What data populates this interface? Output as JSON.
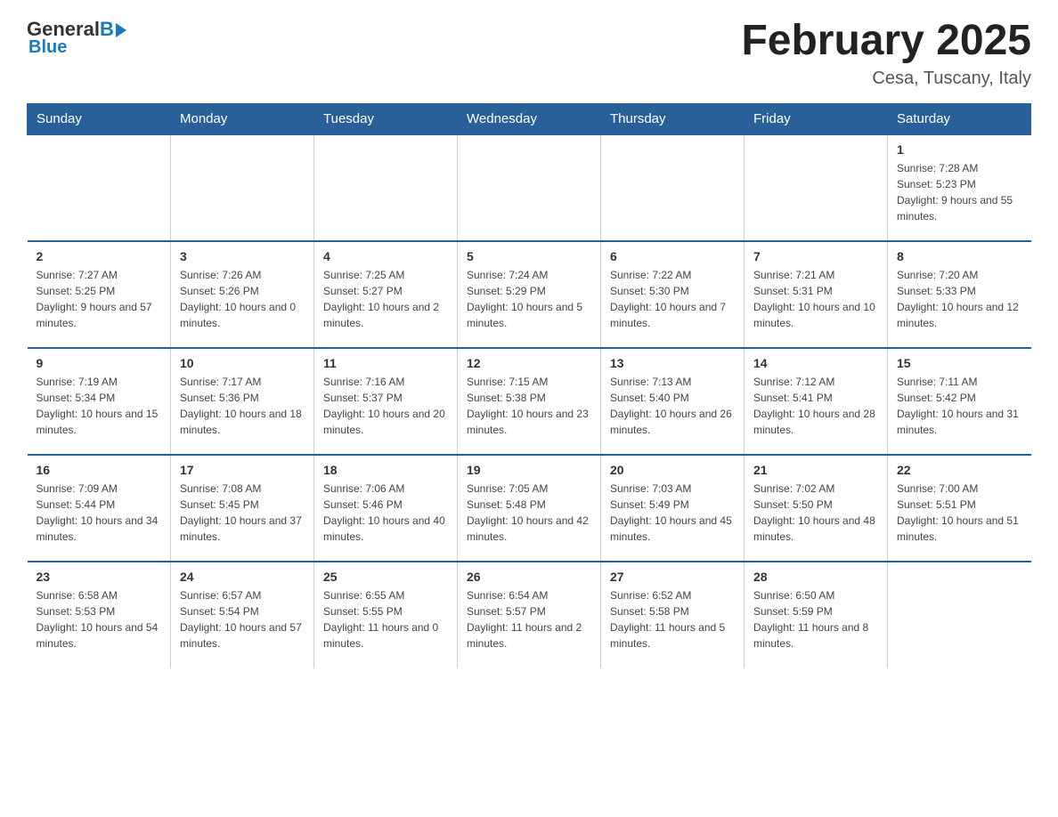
{
  "logo": {
    "general": "General",
    "blue": "Blue",
    "subtitle": "Blue"
  },
  "title": "February 2025",
  "location": "Cesa, Tuscany, Italy",
  "days_of_week": [
    "Sunday",
    "Monday",
    "Tuesday",
    "Wednesday",
    "Thursday",
    "Friday",
    "Saturday"
  ],
  "weeks": [
    [
      {
        "day": "",
        "info": ""
      },
      {
        "day": "",
        "info": ""
      },
      {
        "day": "",
        "info": ""
      },
      {
        "day": "",
        "info": ""
      },
      {
        "day": "",
        "info": ""
      },
      {
        "day": "",
        "info": ""
      },
      {
        "day": "1",
        "info": "Sunrise: 7:28 AM\nSunset: 5:23 PM\nDaylight: 9 hours and 55 minutes."
      }
    ],
    [
      {
        "day": "2",
        "info": "Sunrise: 7:27 AM\nSunset: 5:25 PM\nDaylight: 9 hours and 57 minutes."
      },
      {
        "day": "3",
        "info": "Sunrise: 7:26 AM\nSunset: 5:26 PM\nDaylight: 10 hours and 0 minutes."
      },
      {
        "day": "4",
        "info": "Sunrise: 7:25 AM\nSunset: 5:27 PM\nDaylight: 10 hours and 2 minutes."
      },
      {
        "day": "5",
        "info": "Sunrise: 7:24 AM\nSunset: 5:29 PM\nDaylight: 10 hours and 5 minutes."
      },
      {
        "day": "6",
        "info": "Sunrise: 7:22 AM\nSunset: 5:30 PM\nDaylight: 10 hours and 7 minutes."
      },
      {
        "day": "7",
        "info": "Sunrise: 7:21 AM\nSunset: 5:31 PM\nDaylight: 10 hours and 10 minutes."
      },
      {
        "day": "8",
        "info": "Sunrise: 7:20 AM\nSunset: 5:33 PM\nDaylight: 10 hours and 12 minutes."
      }
    ],
    [
      {
        "day": "9",
        "info": "Sunrise: 7:19 AM\nSunset: 5:34 PM\nDaylight: 10 hours and 15 minutes."
      },
      {
        "day": "10",
        "info": "Sunrise: 7:17 AM\nSunset: 5:36 PM\nDaylight: 10 hours and 18 minutes."
      },
      {
        "day": "11",
        "info": "Sunrise: 7:16 AM\nSunset: 5:37 PM\nDaylight: 10 hours and 20 minutes."
      },
      {
        "day": "12",
        "info": "Sunrise: 7:15 AM\nSunset: 5:38 PM\nDaylight: 10 hours and 23 minutes."
      },
      {
        "day": "13",
        "info": "Sunrise: 7:13 AM\nSunset: 5:40 PM\nDaylight: 10 hours and 26 minutes."
      },
      {
        "day": "14",
        "info": "Sunrise: 7:12 AM\nSunset: 5:41 PM\nDaylight: 10 hours and 28 minutes."
      },
      {
        "day": "15",
        "info": "Sunrise: 7:11 AM\nSunset: 5:42 PM\nDaylight: 10 hours and 31 minutes."
      }
    ],
    [
      {
        "day": "16",
        "info": "Sunrise: 7:09 AM\nSunset: 5:44 PM\nDaylight: 10 hours and 34 minutes."
      },
      {
        "day": "17",
        "info": "Sunrise: 7:08 AM\nSunset: 5:45 PM\nDaylight: 10 hours and 37 minutes."
      },
      {
        "day": "18",
        "info": "Sunrise: 7:06 AM\nSunset: 5:46 PM\nDaylight: 10 hours and 40 minutes."
      },
      {
        "day": "19",
        "info": "Sunrise: 7:05 AM\nSunset: 5:48 PM\nDaylight: 10 hours and 42 minutes."
      },
      {
        "day": "20",
        "info": "Sunrise: 7:03 AM\nSunset: 5:49 PM\nDaylight: 10 hours and 45 minutes."
      },
      {
        "day": "21",
        "info": "Sunrise: 7:02 AM\nSunset: 5:50 PM\nDaylight: 10 hours and 48 minutes."
      },
      {
        "day": "22",
        "info": "Sunrise: 7:00 AM\nSunset: 5:51 PM\nDaylight: 10 hours and 51 minutes."
      }
    ],
    [
      {
        "day": "23",
        "info": "Sunrise: 6:58 AM\nSunset: 5:53 PM\nDaylight: 10 hours and 54 minutes."
      },
      {
        "day": "24",
        "info": "Sunrise: 6:57 AM\nSunset: 5:54 PM\nDaylight: 10 hours and 57 minutes."
      },
      {
        "day": "25",
        "info": "Sunrise: 6:55 AM\nSunset: 5:55 PM\nDaylight: 11 hours and 0 minutes."
      },
      {
        "day": "26",
        "info": "Sunrise: 6:54 AM\nSunset: 5:57 PM\nDaylight: 11 hours and 2 minutes."
      },
      {
        "day": "27",
        "info": "Sunrise: 6:52 AM\nSunset: 5:58 PM\nDaylight: 11 hours and 5 minutes."
      },
      {
        "day": "28",
        "info": "Sunrise: 6:50 AM\nSunset: 5:59 PM\nDaylight: 11 hours and 8 minutes."
      },
      {
        "day": "",
        "info": ""
      }
    ]
  ]
}
